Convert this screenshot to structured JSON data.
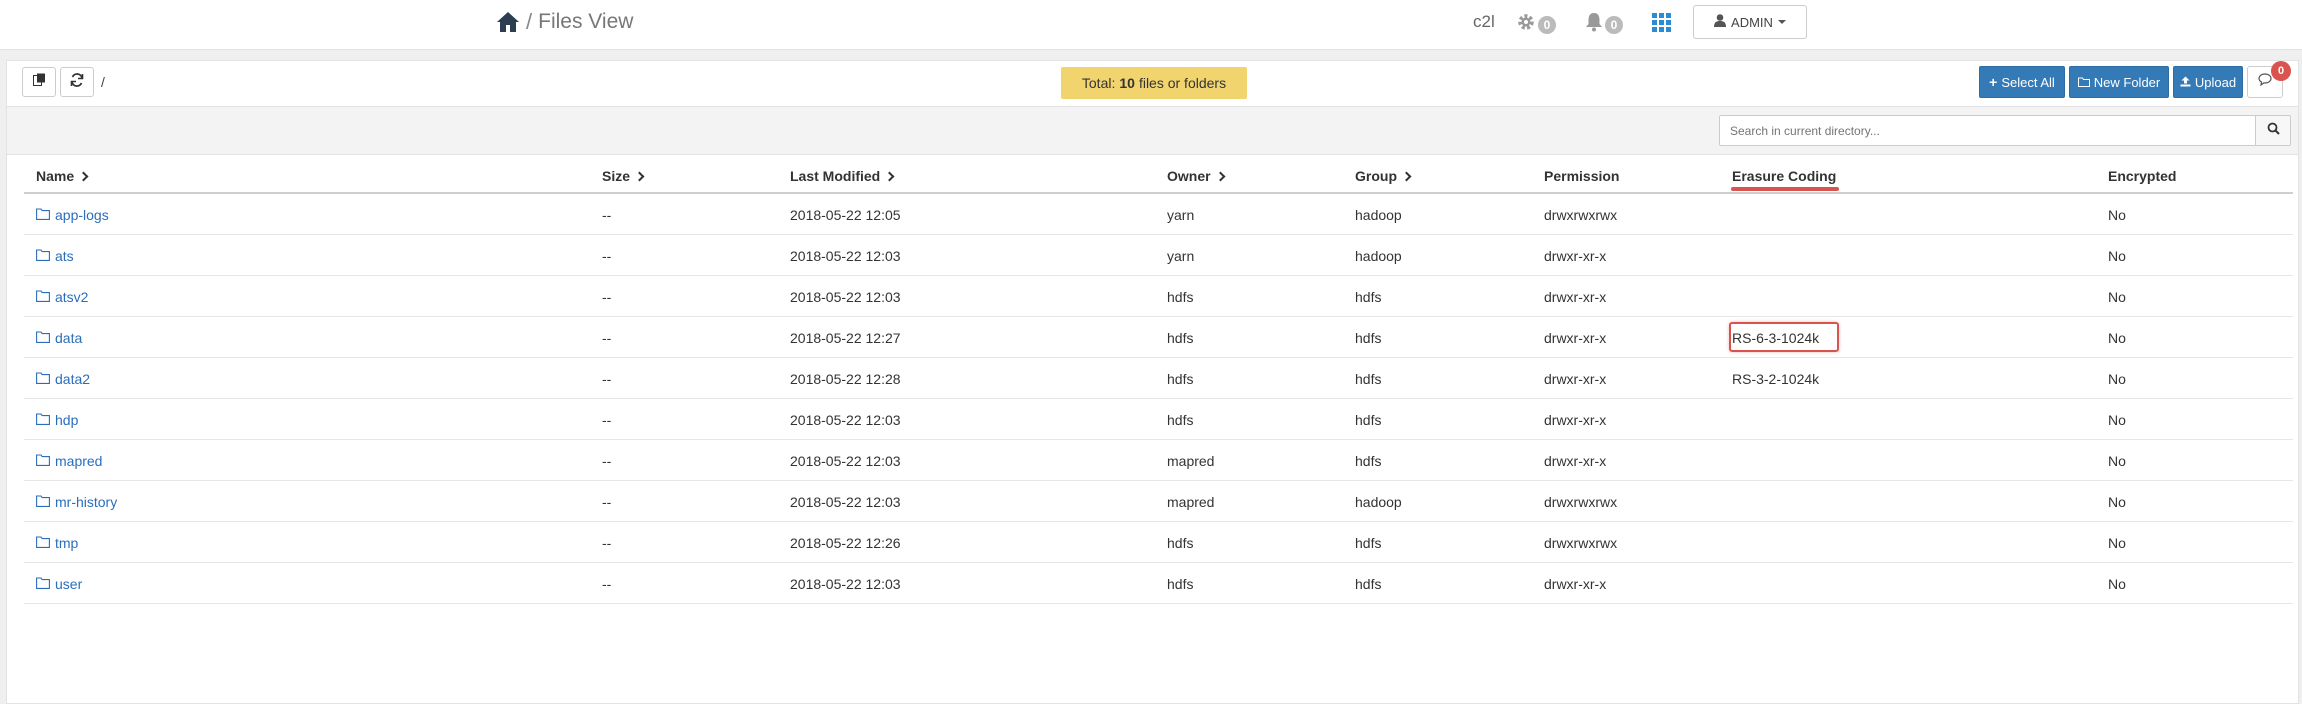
{
  "header": {
    "title": "Files View",
    "breadcrumb_sep": "/",
    "cluster": "c2l",
    "settings_count": "0",
    "alerts_count": "0",
    "user_label": "ADMIN"
  },
  "toolbar": {
    "path": "/",
    "total_prefix": "Total:",
    "total_count": "10",
    "total_suffix": "files or folders",
    "select_all": "Select All",
    "new_folder": "New Folder",
    "upload": "Upload",
    "notifications_count": "0"
  },
  "search": {
    "placeholder": "Search in current directory..."
  },
  "columns": [
    "Name",
    "Size",
    "Last Modified",
    "Owner",
    "Group",
    "Permission",
    "Erasure Coding",
    "Encrypted"
  ],
  "rows": [
    {
      "name": "app-logs",
      "size": "--",
      "modified": "2018-05-22 12:05",
      "owner": "yarn",
      "group": "hadoop",
      "permission": "drwxrwxrwx",
      "ec": "",
      "encrypted": "No"
    },
    {
      "name": "ats",
      "size": "--",
      "modified": "2018-05-22 12:03",
      "owner": "yarn",
      "group": "hadoop",
      "permission": "drwxr-xr-x",
      "ec": "",
      "encrypted": "No"
    },
    {
      "name": "atsv2",
      "size": "--",
      "modified": "2018-05-22 12:03",
      "owner": "hdfs",
      "group": "hdfs",
      "permission": "drwxr-xr-x",
      "ec": "",
      "encrypted": "No"
    },
    {
      "name": "data",
      "size": "--",
      "modified": "2018-05-22 12:27",
      "owner": "hdfs",
      "group": "hdfs",
      "permission": "drwxr-xr-x",
      "ec": "RS-6-3-1024k",
      "encrypted": "No"
    },
    {
      "name": "data2",
      "size": "--",
      "modified": "2018-05-22 12:28",
      "owner": "hdfs",
      "group": "hdfs",
      "permission": "drwxr-xr-x",
      "ec": "RS-3-2-1024k",
      "encrypted": "No"
    },
    {
      "name": "hdp",
      "size": "--",
      "modified": "2018-05-22 12:03",
      "owner": "hdfs",
      "group": "hdfs",
      "permission": "drwxr-xr-x",
      "ec": "",
      "encrypted": "No"
    },
    {
      "name": "mapred",
      "size": "--",
      "modified": "2018-05-22 12:03",
      "owner": "mapred",
      "group": "hdfs",
      "permission": "drwxr-xr-x",
      "ec": "",
      "encrypted": "No"
    },
    {
      "name": "mr-history",
      "size": "--",
      "modified": "2018-05-22 12:03",
      "owner": "mapred",
      "group": "hadoop",
      "permission": "drwxrwxrwx",
      "ec": "",
      "encrypted": "No"
    },
    {
      "name": "tmp",
      "size": "--",
      "modified": "2018-05-22 12:26",
      "owner": "hdfs",
      "group": "hdfs",
      "permission": "drwxrwxrwx",
      "ec": "",
      "encrypted": "No"
    },
    {
      "name": "user",
      "size": "--",
      "modified": "2018-05-22 12:03",
      "owner": "hdfs",
      "group": "hdfs",
      "permission": "drwxr-xr-x",
      "ec": "",
      "encrypted": "No"
    }
  ],
  "colors": {
    "link": "#2a6ebb",
    "primary": "#337ab7",
    "highlight": "#d9534f",
    "total_bg": "#f2d46e"
  },
  "icons": {
    "home": "home-icon",
    "settings": "gear-icon",
    "alerts": "bell-icon",
    "apps": "grid-icon",
    "user": "user-icon",
    "copy": "copy-icon",
    "refresh": "refresh-icon",
    "folder": "folder-icon",
    "search": "search-icon",
    "comment": "comment-icon"
  }
}
